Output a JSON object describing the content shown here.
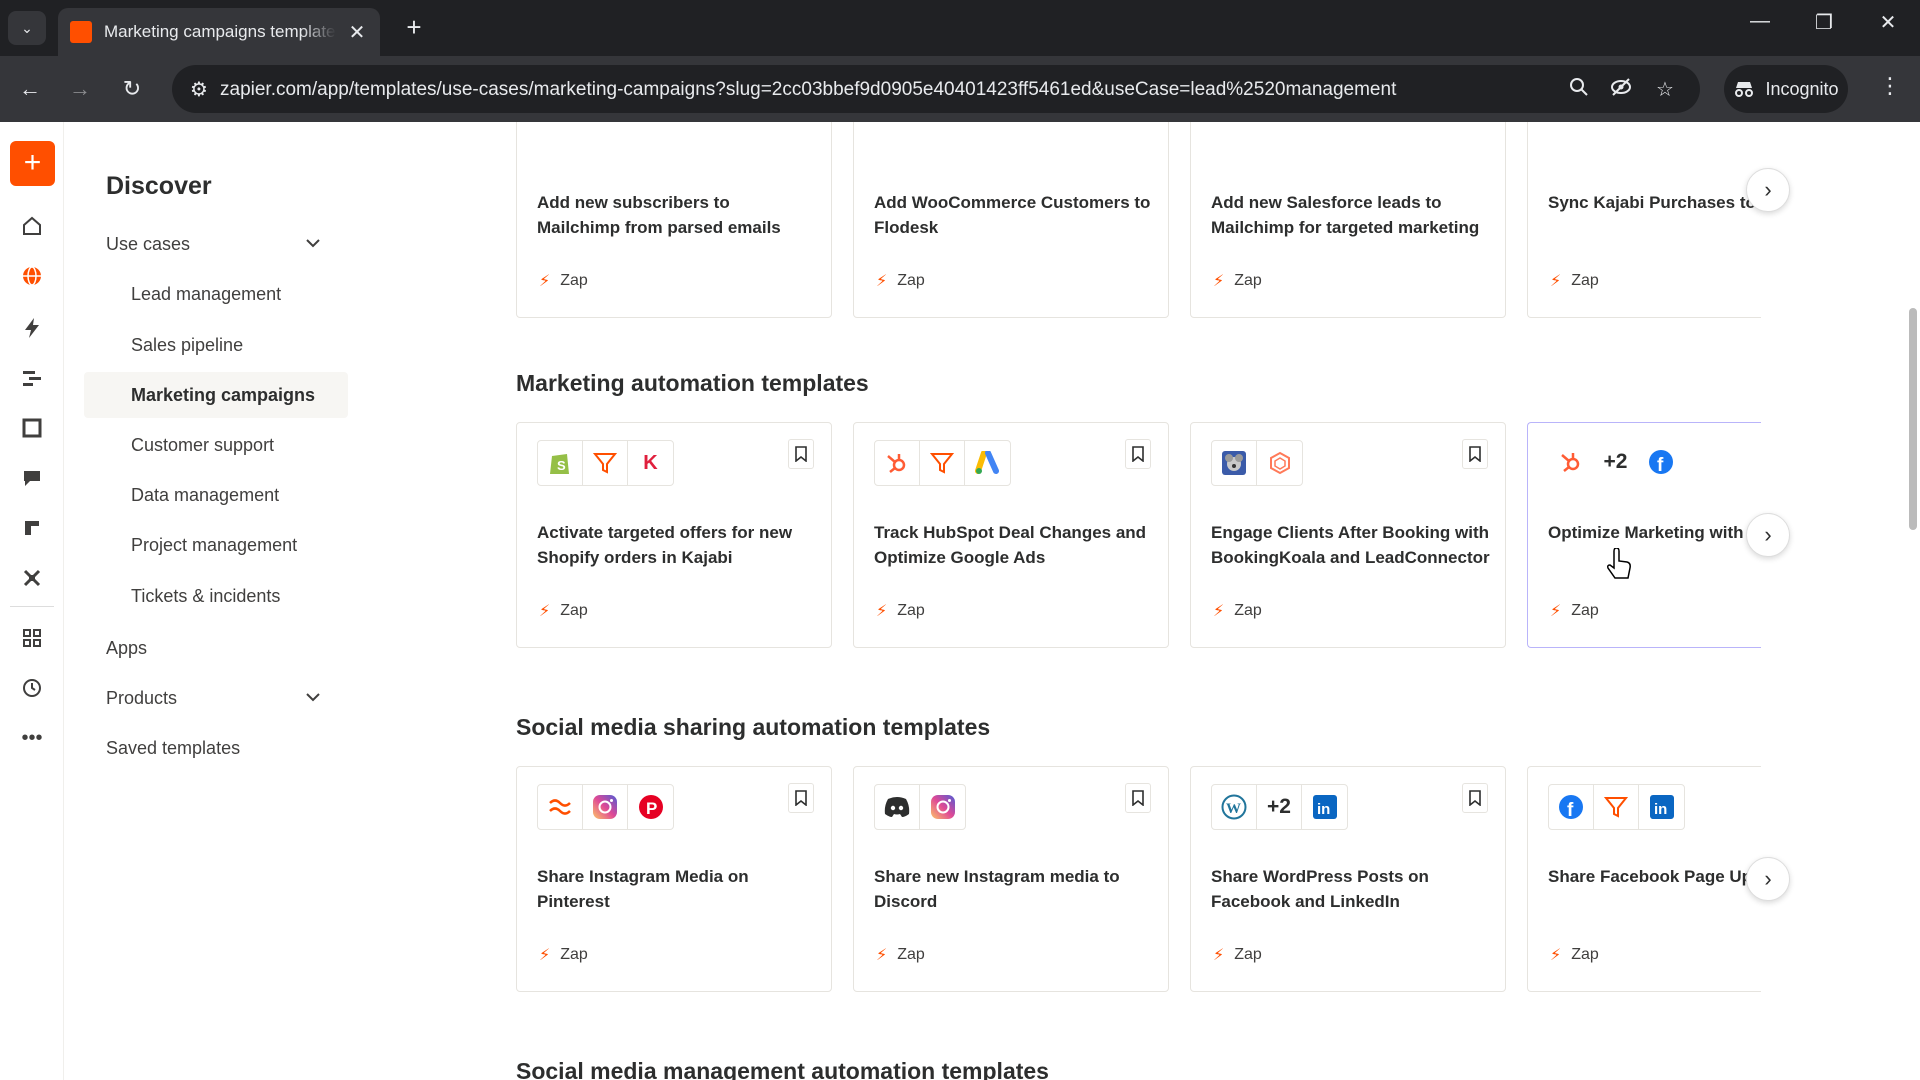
{
  "browser": {
    "tab_title": "Marketing campaigns template",
    "url": "zapier.com/app/templates/use-cases/marketing-campaigns?slug=2cc03bbef9d0905e40401423ff5461ed&useCase=lead%2520management",
    "incognito_label": "Incognito"
  },
  "sidebar": {
    "title": "Discover",
    "use_cases_label": "Use cases",
    "use_cases": [
      "Lead management",
      "Sales pipeline",
      "Marketing campaigns",
      "Customer support",
      "Data management",
      "Project management",
      "Tickets & incidents"
    ],
    "apps_label": "Apps",
    "products_label": "Products",
    "saved_label": "Saved templates"
  },
  "sections": {
    "s1": {
      "title": ""
    },
    "s2": {
      "title": "Marketing automation templates"
    },
    "s3": {
      "title": "Social media sharing automation templates"
    },
    "s4": {
      "title": "Social media management automation templates"
    }
  },
  "cards": {
    "r1c1": {
      "title": "Add new subscribers to\nMailchimp from parsed emails",
      "type": "Zap"
    },
    "r1c2": {
      "title": "Add WooCommerce Customers to\nFlodesk",
      "type": "Zap"
    },
    "r1c3": {
      "title": "Add new Salesforce leads to\nMailchimp for targeted marketing",
      "type": "Zap"
    },
    "r1c4": {
      "title": "Sync Kajabi Purchases to\nSubscribers",
      "type": "Zap"
    },
    "r2c1": {
      "title": "Activate targeted offers for new\nShopify orders in Kajabi",
      "type": "Zap"
    },
    "r2c2": {
      "title": "Track HubSpot Deal Changes and\nOptimize Google Ads",
      "type": "Zap"
    },
    "r2c3": {
      "title": "Engage Clients After Booking with\nBookingKoala and LeadConnector",
      "type": "Zap"
    },
    "r2c4": {
      "title": "Optimize Marketing with\nand Ad Conversions",
      "type": "Zap",
      "extra_apps": "+2"
    },
    "r3c1": {
      "title": "Share Instagram Media on\nPinterest",
      "type": "Zap"
    },
    "r3c2": {
      "title": "Share new Instagram media to\nDiscord",
      "type": "Zap"
    },
    "r3c3": {
      "title": "Share WordPress Posts on\nFacebook and LinkedIn",
      "type": "Zap",
      "extra_apps": "+2"
    },
    "r3c4": {
      "title": "Share Facebook Page Up\nLinkedIn",
      "type": "Zap"
    }
  },
  "colors": {
    "accent": "#ff4f00",
    "hover_border": "#b9b4fa"
  }
}
